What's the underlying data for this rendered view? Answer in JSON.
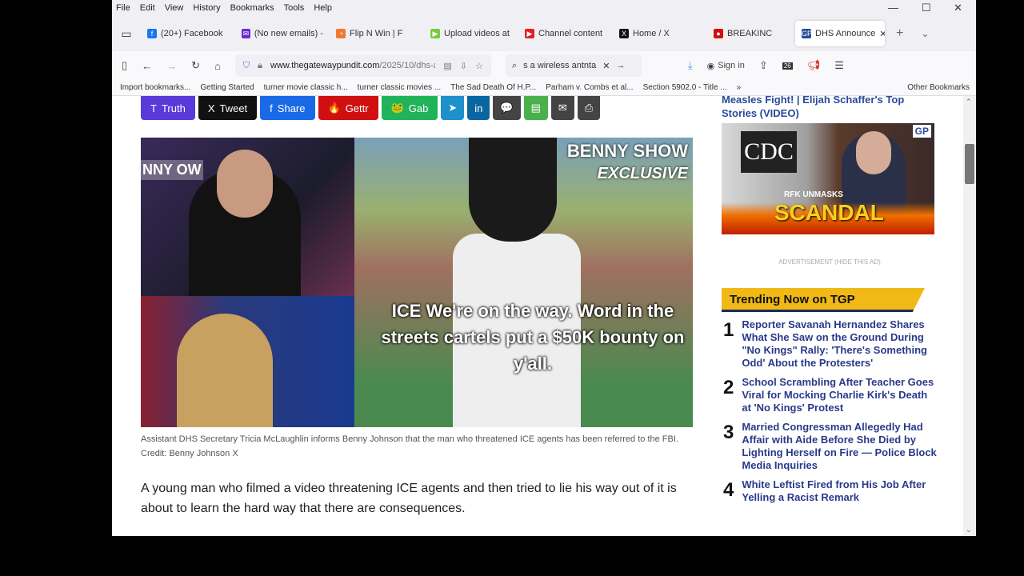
{
  "menu": [
    "File",
    "Edit",
    "View",
    "History",
    "Bookmarks",
    "Tools",
    "Help"
  ],
  "window_controls": {
    "minimize": "—",
    "maximize": "☐",
    "close": "✕"
  },
  "tabs": [
    {
      "label": "(20+) Facebook",
      "color": "#1877f2",
      "glyph": "f"
    },
    {
      "label": "(No new emails) -",
      "color": "#6a2ad0",
      "glyph": "✉"
    },
    {
      "label": "Flip N Win | F",
      "color": "#f07a30",
      "glyph": "◔"
    },
    {
      "label": "Upload videos at",
      "color": "#7acb3a",
      "glyph": "▶"
    },
    {
      "label": "Channel content",
      "color": "#e02020",
      "glyph": "▶"
    },
    {
      "label": "Home / X",
      "color": "#111",
      "glyph": "X"
    },
    {
      "label": "BREAKINC",
      "color": "#d01010",
      "glyph": "●"
    },
    {
      "label": "DHS Announce",
      "color": "#2a4a9a",
      "glyph": "GP"
    }
  ],
  "nav": {
    "url_domain": "www.thegatewaypundit.com",
    "url_path": "/2025/10/dhs-anno",
    "search_value": "s a wireless antnta",
    "sign_in": "Sign in",
    "badge": "26"
  },
  "bookmarks": [
    "Import bookmarks...",
    "Getting Started",
    "turner movie classic h...",
    "turner classic movies ...",
    "The Sad Death Of H.P...",
    "Parham v. Combs et al...",
    "Section 5902.0 - Title ...",
    "Other Bookmarks"
  ],
  "share": [
    {
      "label": "Truth",
      "color": "#5a3ad8",
      "icon": "T"
    },
    {
      "label": "Tweet",
      "color": "#111111",
      "icon": "X"
    },
    {
      "label": "Share",
      "color": "#1a6ae8",
      "icon": "f"
    },
    {
      "label": "Gettr",
      "color": "#d01010",
      "icon": "🔥"
    },
    {
      "label": "Gab",
      "color": "#21b35a",
      "icon": "🐸"
    },
    {
      "label": "",
      "color": "#1e90cc",
      "icon": "➤"
    },
    {
      "label": "",
      "color": "#0a66a2",
      "icon": "in"
    },
    {
      "label": "",
      "color": "#444444",
      "icon": "💬"
    },
    {
      "label": "",
      "color": "#4ab04a",
      "icon": "▤"
    },
    {
      "label": "",
      "color": "#444444",
      "icon": "✉"
    },
    {
      "label": "",
      "color": "#444444",
      "icon": "⎙"
    }
  ],
  "hero": {
    "overlay_text": "ICE We're on the way. Word in the streets cartels put a $50K bounty on y'all.",
    "show_logo": "BENNY SHOW",
    "exclusive": "EXCLUSIVE",
    "left_logo": "NNY OW"
  },
  "caption": "Assistant DHS Secretary Tricia McLaughlin informs Benny Johnson that the man who threatened ICE agents has been referred to the FBI. Credit: Benny Johnson X",
  "paragraph": "A young man who filmed a video threatening ICE agents and then tried to lie his way out of it is about to learn the hard way that there are consequences.",
  "sidebar": {
    "prev_title": "Measles Fight! | Elijah Schaffer's Top Stories (VIDEO)",
    "ad": {
      "cdc": "CDC",
      "kicker": "RFK UNMASKS",
      "headline": "SCANDAL",
      "badge": "GP"
    },
    "ad_label": "ADVERTISEMENT (HIDE THIS AD)",
    "trending_title": "Trending Now on TGP",
    "trending": [
      {
        "n": "1",
        "title": "Reporter Savanah Hernandez Shares What She Saw on the Ground During \"No Kings\" Rally: 'There's Something Odd' About the Protesters'"
      },
      {
        "n": "2",
        "title": "School Scrambling After Teacher Goes Viral for Mocking Charlie Kirk's Death at 'No Kings' Protest"
      },
      {
        "n": "3",
        "title": "Married Congressman Allegedly Had Affair with Aide Before She Died by Lighting Herself on Fire — Police Block Media Inquiries"
      },
      {
        "n": "4",
        "title": "White Leftist Fired from His Job After Yelling a Racist Remark"
      }
    ]
  }
}
